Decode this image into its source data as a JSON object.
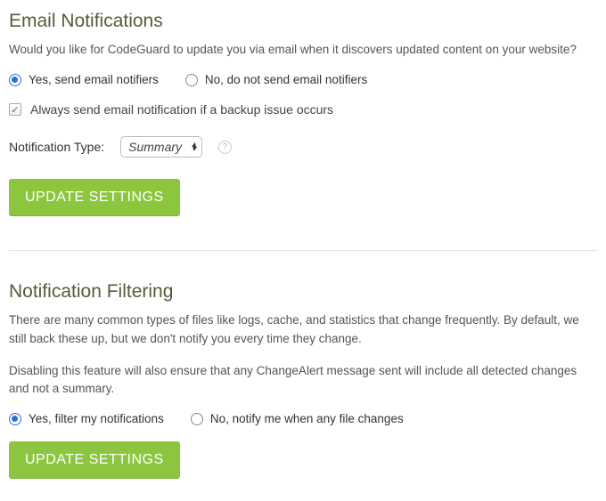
{
  "email": {
    "heading": "Email Notifications",
    "question": "Would you like for CodeGuard to update you via email when it discovers updated content on your website?",
    "radio_yes": "Yes, send email notifiers",
    "radio_no": "No, do not send email notifiers",
    "checkbox_label": "Always send email notification if a backup issue occurs",
    "type_label": "Notification Type:",
    "type_value": "Summary",
    "button": "UPDATE SETTINGS"
  },
  "filtering": {
    "heading": "Notification Filtering",
    "para1": "There are many common types of files like logs, cache, and statistics that change frequently. By default, we still back these up, but we don't notify you every time they change.",
    "para2": "Disabling this feature will also ensure that any ChangeAlert message sent will include all detected changes and not a summary.",
    "radio_yes": "Yes, filter my notifications",
    "radio_no": "No, notify me when any file changes",
    "button": "UPDATE SETTINGS"
  }
}
